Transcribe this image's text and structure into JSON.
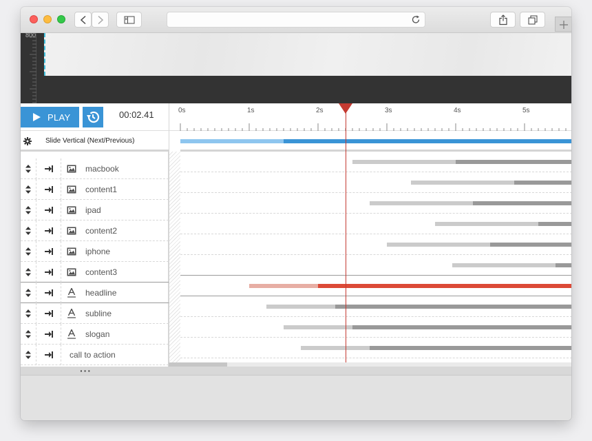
{
  "ruler": {
    "top_label": "800"
  },
  "controls": {
    "play_label": "PLAY",
    "time": "00:02.41"
  },
  "timeline": {
    "ticks": [
      "0s",
      "1s",
      "2s",
      "3s",
      "4s",
      "5s"
    ],
    "seconds_visible": 5.7,
    "playhead_seconds": 2.41
  },
  "slide": {
    "name": "Slide Vertical (Next/Previous)",
    "bar": {
      "start": 0,
      "split": 1.5,
      "end": 5.7
    }
  },
  "layers": [
    {
      "name": "macbook",
      "type": "image",
      "start": 2.5,
      "split": 4.0,
      "end": 5.7
    },
    {
      "name": "content1",
      "type": "image",
      "start": 3.35,
      "split": 4.85,
      "end": 5.7
    },
    {
      "name": "ipad",
      "type": "image",
      "start": 2.75,
      "split": 4.25,
      "end": 5.7
    },
    {
      "name": "content2",
      "type": "image",
      "start": 3.7,
      "split": 5.2,
      "end": 5.7
    },
    {
      "name": "iphone",
      "type": "image",
      "start": 3.0,
      "split": 4.5,
      "end": 5.7
    },
    {
      "name": "content3",
      "type": "image",
      "start": 3.95,
      "split": 5.45,
      "end": 5.7
    },
    {
      "name": "headline",
      "type": "text",
      "start": 1.0,
      "split": 2.0,
      "end": 5.7,
      "selected": true
    },
    {
      "name": "subline",
      "type": "text",
      "start": 1.25,
      "split": 2.25,
      "end": 5.7
    },
    {
      "name": "slogan",
      "type": "text",
      "start": 1.5,
      "split": 2.5,
      "end": 5.7
    },
    {
      "name": "call to action",
      "type": "button",
      "start": 1.75,
      "split": 2.75,
      "end": 5.7
    }
  ],
  "colors": {
    "accent": "#3a94d6",
    "playhead": "#c43a31",
    "selected_bar": "#dc4a37"
  },
  "icons": {
    "play": "play-icon",
    "history": "history-icon",
    "gear": "gear-icon",
    "move": "up-down-arrows-icon",
    "transition": "arrow-to-right-icon",
    "image": "image-icon",
    "text": "text-icon"
  }
}
